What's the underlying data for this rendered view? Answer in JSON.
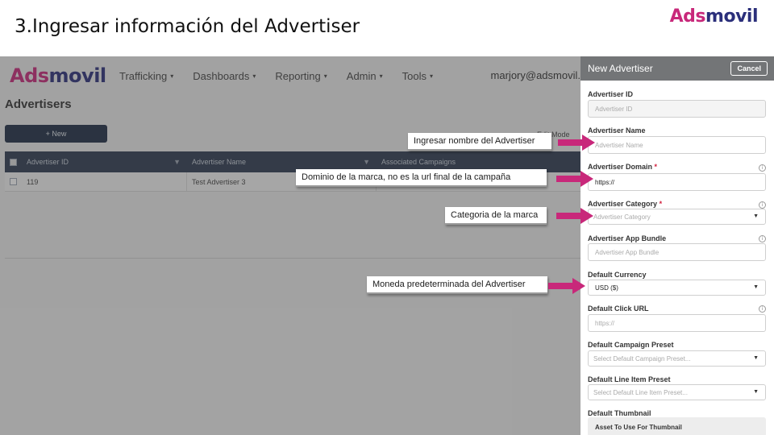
{
  "slide": {
    "title": "3.Ingresar información del Advertiser",
    "logo": {
      "ads": "Ads",
      "movil": "movil"
    }
  },
  "app": {
    "logo": {
      "ads": "Ads",
      "movil": "movil"
    },
    "nav": [
      {
        "label": "Trafficking",
        "caret": "▾"
      },
      {
        "label": "Dashboards",
        "caret": "▾"
      },
      {
        "label": "Reporting",
        "caret": "▾"
      },
      {
        "label": "Admin",
        "caret": "▾"
      },
      {
        "label": "Tools",
        "caret": "▾"
      }
    ],
    "user_email": "marjory@adsmovil.",
    "page_title": "Advertisers",
    "new_button": "+ New",
    "edit_mode": "Edit Mode",
    "table": {
      "headers": [
        "Advertiser ID",
        "Advertiser Name",
        "Associated Campaigns"
      ],
      "rows": [
        {
          "id": "119",
          "name": "Test Advertiser 3"
        }
      ]
    }
  },
  "panel": {
    "title": "New Advertiser",
    "cancel": "Cancel",
    "fields": {
      "advertiser_id": {
        "label": "Advertiser ID",
        "placeholder": "Advertiser ID"
      },
      "advertiser_name": {
        "label": "Advertiser Name",
        "placeholder": "Advertiser Name"
      },
      "advertiser_domain": {
        "label": "Advertiser Domain",
        "value": "https://",
        "required": "*"
      },
      "advertiser_category": {
        "label": "Advertiser Category",
        "placeholder": "Advertiser Category",
        "required": "*"
      },
      "app_bundle": {
        "label": "Advertiser App Bundle",
        "placeholder": "Advertiser App Bundle"
      },
      "default_currency": {
        "label": "Default Currency",
        "value": "USD ($)"
      },
      "default_click_url": {
        "label": "Default Click URL",
        "placeholder": "https://"
      },
      "campaign_preset": {
        "label": "Default Campaign Preset",
        "placeholder": "Select Default Campaign Preset..."
      },
      "line_item_preset": {
        "label": "Default Line Item Preset",
        "placeholder": "Select Default Line Item Preset..."
      },
      "thumbnail": {
        "label": "Default Thumbnail",
        "asset": "Asset To Use For Thumbnail"
      }
    }
  },
  "callouts": {
    "name": "Ingresar nombre del Advertiser",
    "domain": "Dominio de la marca, no es la url final de la campaña",
    "category": "Categoria de la marca",
    "currency": "Moneda predeterminada del Advertiser"
  },
  "colors": {
    "brand_pink": "#c8287a",
    "brand_navy": "#2b2f7a",
    "arrow": "#c8287a",
    "panel_header": "#737577",
    "required": "#d21f3c"
  }
}
